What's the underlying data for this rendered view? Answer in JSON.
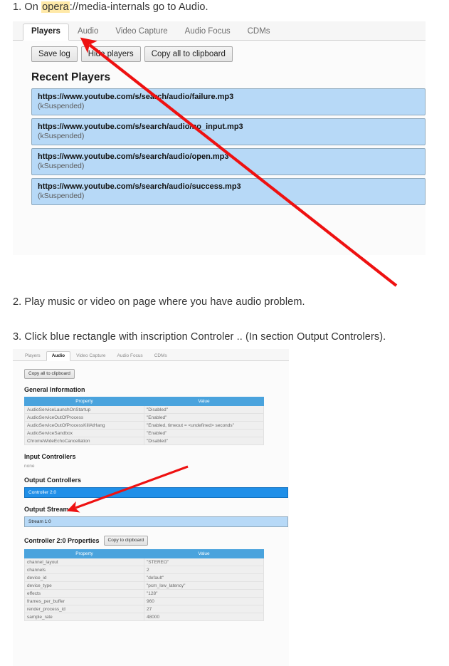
{
  "steps": {
    "s1_pre": "1. On ",
    "s1_hl": "opera",
    "s1_post": "://media-internals go to Audio.",
    "s2": "2. Play music or video on page where you have audio problem.",
    "s3": "3. Click blue rectangle with inscription Controler .. (In section Output Controlers)."
  },
  "colors": {
    "highlight": "#ffe9a8",
    "arrow": "#ee1111",
    "selected_controller": "#1f8fe8",
    "row_blue": "#b7d9f7",
    "table_header": "#4aa3dd"
  },
  "screenshot1": {
    "tabs": [
      {
        "label": "Players",
        "active": true
      },
      {
        "label": "Audio",
        "active": false
      },
      {
        "label": "Video Capture",
        "active": false
      },
      {
        "label": "Audio Focus",
        "active": false
      },
      {
        "label": "CDMs",
        "active": false
      }
    ],
    "buttons": [
      {
        "label": "Save log"
      },
      {
        "label": "Hide players"
      },
      {
        "label": "Copy all to clipboard"
      }
    ],
    "section_title": "Recent Players",
    "players": [
      {
        "url": "https://www.youtube.com/s/search/audio/failure.mp3",
        "state": "(kSuspended)"
      },
      {
        "url": "https://www.youtube.com/s/search/audio/no_input.mp3",
        "state": "(kSuspended)"
      },
      {
        "url": "https://www.youtube.com/s/search/audio/open.mp3",
        "state": "(kSuspended)"
      },
      {
        "url": "https://www.youtube.com/s/search/audio/success.mp3",
        "state": "(kSuspended)"
      }
    ]
  },
  "screenshot2": {
    "tabs": [
      {
        "label": "Players",
        "active": false
      },
      {
        "label": "Audio",
        "active": true
      },
      {
        "label": "Video Capture",
        "active": false
      },
      {
        "label": "Audio Focus",
        "active": false
      },
      {
        "label": "CDMs",
        "active": false
      }
    ],
    "copy_all_button": "Copy all to clipboard",
    "general_information": {
      "title": "General Information",
      "headers": [
        "Property",
        "Value"
      ],
      "rows": [
        [
          "AudioServiceLaunchOnStartup",
          "\"Disabled\""
        ],
        [
          "AudioServiceOutOfProcess",
          "\"Enabled\""
        ],
        [
          "AudioServiceOutOfProcessKillAtHang",
          "\"Enabled, timeout = <undefined> seconds\""
        ],
        [
          "AudioServiceSandbox",
          "\"Enabled\""
        ],
        [
          "ChromeWideEchoCancellation",
          "\"Disabled\""
        ]
      ]
    },
    "input_controllers": {
      "title": "Input Controllers",
      "empty_text": "none"
    },
    "output_controllers": {
      "title": "Output Controllers",
      "selected": "Controller 2:0"
    },
    "output_streams": {
      "title": "Output Streams",
      "items": [
        "Stream 1:0"
      ]
    },
    "controller_properties": {
      "title": "Controller 2:0 Properties",
      "copy_button": "Copy to clipboard",
      "headers": [
        "Property",
        "Value"
      ],
      "rows": [
        [
          "channel_layout",
          "\"STEREO\""
        ],
        [
          "channels",
          "2"
        ],
        [
          "device_id",
          "\"default\""
        ],
        [
          "device_type",
          "\"pcm_low_latency\""
        ],
        [
          "effects",
          "\"128\""
        ],
        [
          "frames_per_buffer",
          "960"
        ],
        [
          "render_process_id",
          "27"
        ],
        [
          "sample_rate",
          "48000"
        ]
      ]
    }
  }
}
